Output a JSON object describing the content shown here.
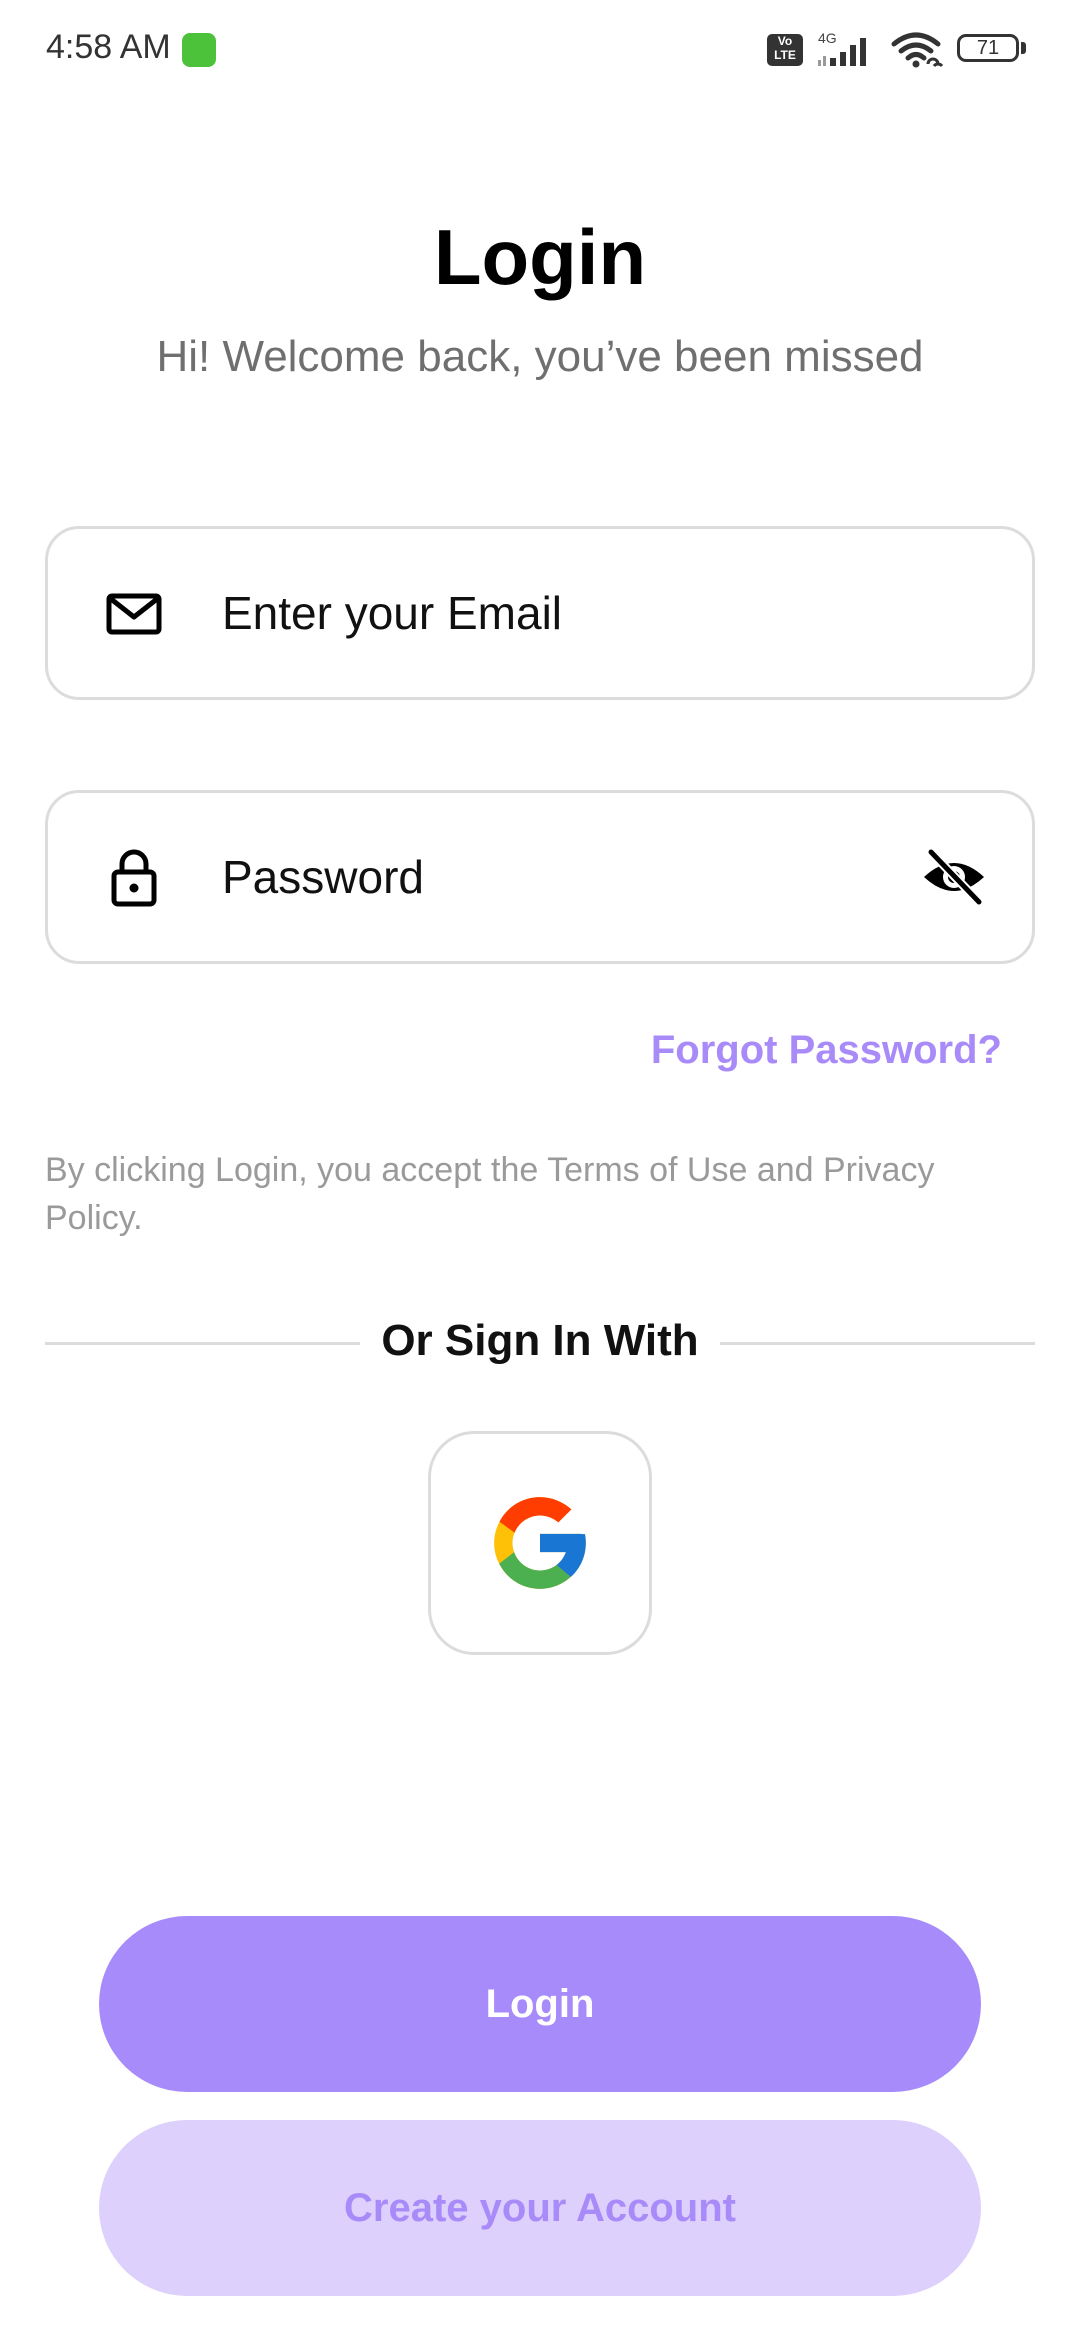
{
  "status_bar": {
    "time": "4:58 AM",
    "volte": "Vo LTE",
    "network": "4G",
    "battery": "71"
  },
  "header": {
    "title": "Login",
    "subtitle": "Hi! Welcome back, you’ve been missed"
  },
  "form": {
    "email_placeholder": "Enter your Email",
    "password_placeholder": "Password",
    "forgot_password": "Forgot Password?",
    "terms": "By clicking Login, you accept the Terms of Use and Privacy Policy."
  },
  "social": {
    "divider_label": "Or Sign In With",
    "provider": "google-icon"
  },
  "actions": {
    "login_label": "Login",
    "create_account_label": "Create your Account"
  },
  "colors": {
    "accent": "#a88bfa",
    "accent_light": "#ddd0fc",
    "border": "#dcdcdc",
    "muted_text": "#9a9a9a"
  }
}
